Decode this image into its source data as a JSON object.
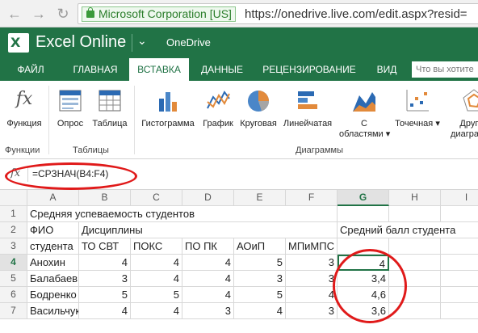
{
  "browser": {
    "site_identity": "Microsoft Corporation [US]",
    "url": "https://onedrive.live.com/edit.aspx?resid="
  },
  "header": {
    "app_title": "Excel Online",
    "location": "OneDrive"
  },
  "tabs": [
    "ФАЙЛ",
    "ГЛАВНАЯ",
    "ВСТАВКА",
    "ДАННЫЕ",
    "РЕЦЕНЗИРОВАНИЕ",
    "ВИД"
  ],
  "active_tab": "ВСТАВКА",
  "tell_me_placeholder": "Что вы хотите",
  "ribbon": {
    "function": "Функция",
    "survey": "Опрос",
    "table": "Таблица",
    "histogram": "Гистограмма",
    "line": "График",
    "pie": "Круговая",
    "bar": "Линейчатая",
    "area_1": "С",
    "area_2": "областями",
    "scatter": "Точечная",
    "other_1": "Другие",
    "other_2": "диаграммы",
    "group_functions": "Функции",
    "group_tables": "Таблицы",
    "group_charts": "Диаграммы"
  },
  "formula": "=СРЗНАЧ(B4:F4)",
  "columns": [
    "A",
    "B",
    "C",
    "D",
    "E",
    "F",
    "G",
    "H",
    "I"
  ],
  "rows": [
    "1",
    "2",
    "3",
    "4",
    "5",
    "6",
    "7"
  ],
  "cells": {
    "A1": "Средняя успеваемость студентов",
    "A2": "ФИО",
    "B2": "Дисциплины",
    "G2": "Средний балл студента",
    "A3": "студента",
    "B3": "ТО СВТ",
    "C3": "ПОКС",
    "D3": "ПО ПК",
    "E3": "АОиП",
    "F3": "МПиМПС",
    "A4": "Анохин",
    "B4": "4",
    "C4": "4",
    "D4": "4",
    "E4": "5",
    "F4": "3",
    "G4": "4",
    "A5": "Балабаев",
    "B5": "3",
    "C5": "4",
    "D5": "4",
    "E5": "3",
    "F5": "3",
    "G5": "3,4",
    "A6": "Бодренко",
    "B6": "5",
    "C6": "5",
    "D6": "4",
    "E6": "5",
    "F6": "4",
    "G6": "4,6",
    "A7": "Васильчук",
    "B7": "4",
    "C7": "4",
    "D7": "3",
    "E7": "4",
    "F7": "3",
    "G7": "3,6"
  },
  "colors": {
    "excel_green": "#217346",
    "annotation_red": "#e01a1a"
  }
}
